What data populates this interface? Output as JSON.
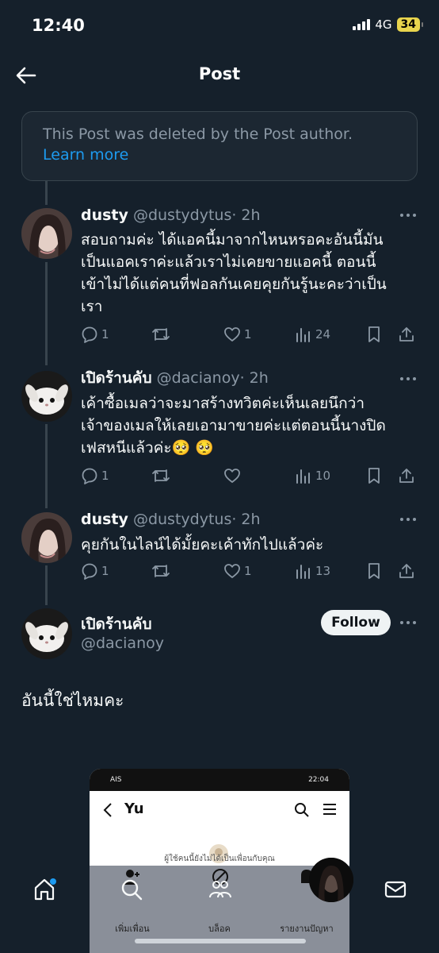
{
  "status_bar": {
    "time": "12:40",
    "network": "4G",
    "battery": "34"
  },
  "header": {
    "title": "Post"
  },
  "deleted_notice": {
    "text": "This Post was deleted by the Post author.",
    "link": "Learn more"
  },
  "replies": [
    {
      "name": "dusty",
      "handle": "@dustydytus",
      "time": "· 2h",
      "lines": [
        "สอบถามค่ะ ได้แอคนี้มาจากไหนหรอคะอันนี้มัน",
        "เป็นแอคเราค่ะแล้วเราไม่เคยขายแอคนี้ ตอนนี้",
        "เข้าไม่ได้แต่คนที่ฟอลกันเคยคุยกันรู้นะคะว่าเป็น",
        "เรา"
      ],
      "replies": "1",
      "reposts": "",
      "likes": "1",
      "views": "24"
    },
    {
      "name": "เปิดร้านคับ",
      "handle": "@dacianoy",
      "time": "· 2h",
      "lines": [
        "เค้าซื้อเมลว่าจะมาสร้างทวิตค่ะเห็นเลยนึกว่า",
        "เจ้าของเมลให้เลยเอามาขายค่ะแต่ตอนนี้นางปิด",
        "เฟสหนีแล้วค่ะ🥺 🥺"
      ],
      "replies": "1",
      "reposts": "",
      "likes": "",
      "views": "10"
    },
    {
      "name": "dusty",
      "handle": "@dustydytus",
      "time": "· 2h",
      "lines": [
        "คุยกันในไลน์ได้มั้ยคะเค้าทักไปแล้วค่ะ"
      ],
      "replies": "1",
      "reposts": "",
      "likes": "1",
      "views": "13"
    }
  ],
  "main_post": {
    "name": "เปิดร้านคับ",
    "handle": "@dacianoy",
    "follow_label": "Follow",
    "text": "อันนี้ใช่ไหมคะ"
  },
  "embedded_screenshot": {
    "status_left": "AIS",
    "status_time": "22:04",
    "title": "Yu",
    "hint": "ผู้ใช้คนนี้ยังไม่ได้เป็นเพื่อนกับคุณ",
    "actions": [
      "เพิ่มเพื่อน",
      "บล็อค",
      "รายงานปัญหา"
    ]
  },
  "colors": {
    "background": "#15202b",
    "accent": "#1d9bf0",
    "muted": "#8b98a5"
  }
}
